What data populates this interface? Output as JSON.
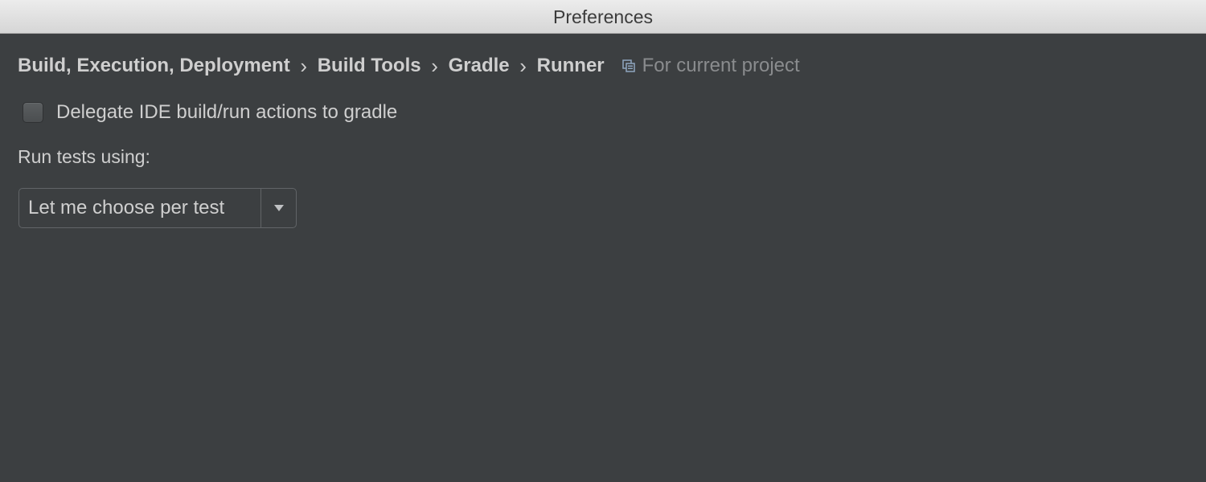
{
  "window": {
    "title": "Preferences"
  },
  "breadcrumb": {
    "items": [
      "Build, Execution, Deployment",
      "Build Tools",
      "Gradle",
      "Runner"
    ],
    "separator": "›",
    "scope_icon": "project-scope-icon",
    "scope_label": "For current project"
  },
  "options": {
    "delegate_label": "Delegate IDE build/run actions to gradle",
    "delegate_checked": false,
    "run_tests_label": "Run tests using:",
    "run_tests_value": "Let me choose per test",
    "dropdown_icon": "chevron-down-icon"
  },
  "colors": {
    "background": "#3c3f41",
    "text": "#cfcfcf",
    "muted_text": "#8a8c8e",
    "titlebar": "#e4e4e4"
  }
}
